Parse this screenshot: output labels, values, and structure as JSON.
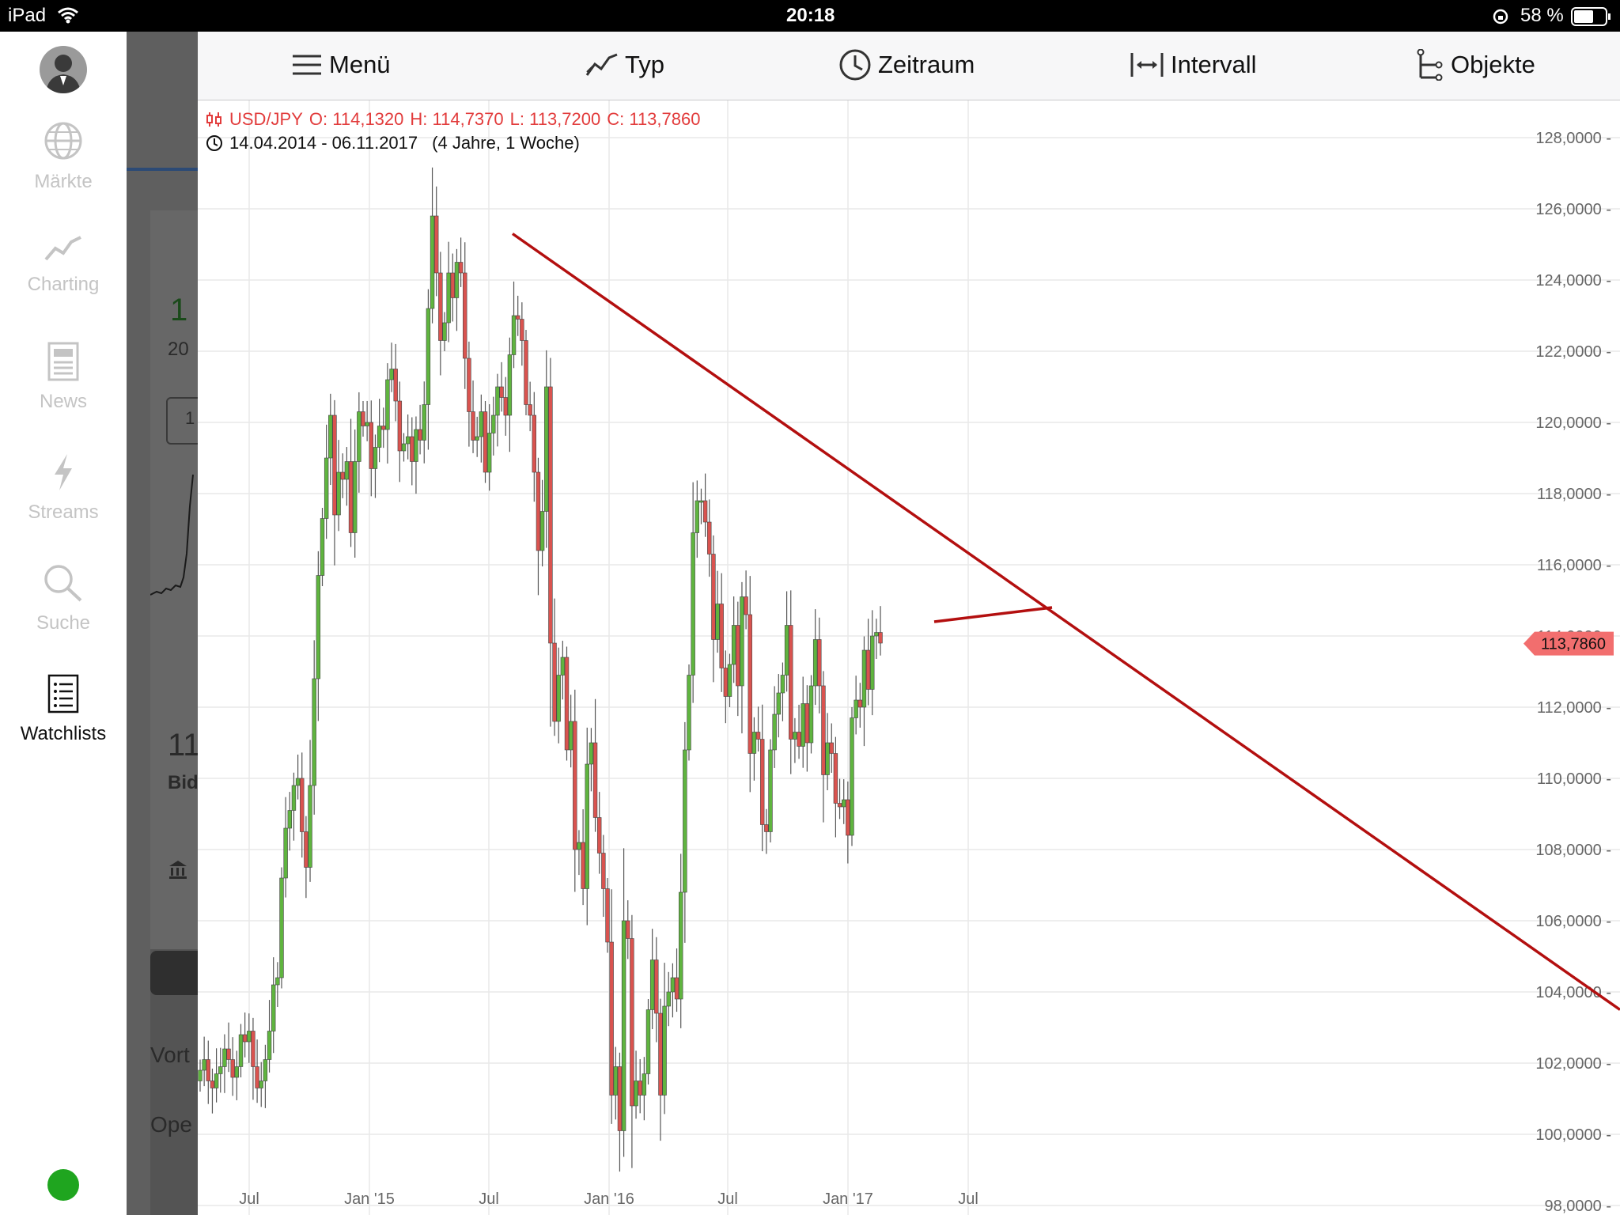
{
  "status_bar": {
    "device": "iPad",
    "time": "20:18",
    "battery": "58 %"
  },
  "sidebar": {
    "items": [
      {
        "label": "Märkte",
        "icon": "globe-icon",
        "active": false
      },
      {
        "label": "Charting",
        "icon": "chart-line-icon",
        "active": false
      },
      {
        "label": "News",
        "icon": "newspaper-icon",
        "active": false
      },
      {
        "label": "Streams",
        "icon": "lightning-icon",
        "active": false
      },
      {
        "label": "Suche",
        "icon": "search-icon",
        "active": false
      },
      {
        "label": "Watchlists",
        "icon": "list-icon",
        "active": true
      }
    ],
    "status_color": "#1fa51f"
  },
  "background_panel": {
    "fragments": [
      "1",
      "20",
      "1",
      "11",
      "Bid",
      "Vort",
      "Ope"
    ]
  },
  "toolbar": {
    "menu": "Menü",
    "type": "Typ",
    "period": "Zeitraum",
    "interval": "Intervall",
    "objects": "Objekte"
  },
  "instrument": {
    "symbol": "USD/JPY",
    "open": "O: 114,1320",
    "high": "H: 114,7370",
    "low": "L: 113,7200",
    "close": "C: 113,7860",
    "range": "14.04.2014 - 06.11.2017",
    "duration": "(4 Jahre, 1 Woche)"
  },
  "chart_data": {
    "type": "candlestick",
    "y_ticks": [
      "128,0000",
      "126,0000",
      "124,0000",
      "122,0000",
      "120,0000",
      "118,0000",
      "116,0000",
      "114,0000",
      "112,0000",
      "110,0000",
      "108,0000",
      "106,0000",
      "104,0000",
      "102,0000",
      "100,0000",
      "98,0000"
    ],
    "ylim": [
      98,
      128
    ],
    "x_ticks": [
      "Jul",
      "Jan '15",
      "Jul",
      "Jan '16",
      "Jul",
      "Jan '17",
      "Jul"
    ],
    "last_price": "113,7860",
    "up_color": "#5fb43f",
    "down_color": "#d9534f",
    "trendline_color": "#b30f0f",
    "weekly_closes": [
      101.8,
      102.1,
      101.5,
      101.3,
      101.7,
      101.9,
      102.4,
      102.1,
      101.6,
      101.9,
      102.8,
      102.6,
      102.9,
      101.9,
      101.3,
      101.5,
      102.1,
      102.9,
      104.2,
      104.4,
      107.2,
      108.6,
      109.1,
      109.8,
      110.0,
      108.5,
      107.5,
      109.8,
      112.8,
      115.7,
      117.3,
      119.0,
      120.2,
      117.4,
      118.6,
      118.4,
      118.9,
      116.9,
      118.9,
      120.3,
      119.9,
      120.0,
      118.7,
      119.3,
      119.9,
      119.8,
      121.2,
      121.5,
      120.6,
      119.2,
      119.4,
      119.6,
      118.9,
      119.8,
      119.5,
      120.5,
      123.2,
      125.8,
      124.2,
      122.3,
      122.8,
      124.2,
      123.5,
      124.5,
      124.2,
      121.8,
      120.3,
      119.5,
      119.6,
      120.3,
      118.6,
      119.7,
      120.2,
      121.0,
      120.7,
      120.2,
      121.9,
      123.0,
      122.9,
      122.3,
      120.5,
      120.2,
      118.6,
      116.4,
      117.5,
      121.0,
      113.8,
      111.6,
      112.9,
      113.4,
      110.8,
      111.6,
      108.0,
      108.2,
      106.9,
      110.4,
      111.0,
      108.9,
      107.9,
      106.9,
      105.4,
      101.1,
      101.9,
      100.1,
      106.0,
      105.5,
      100.8,
      101.5,
      101.1,
      101.7,
      103.5,
      104.9,
      103.4,
      101.1,
      103.6,
      104.0,
      104.4,
      103.8,
      106.8,
      110.8,
      112.9,
      116.9,
      117.8,
      117.8,
      117.2,
      116.3,
      113.9,
      114.9,
      113.1,
      112.3,
      113.2,
      114.3,
      112.6,
      115.1,
      114.6,
      110.7,
      111.3,
      111.1,
      108.7,
      108.5,
      110.8,
      111.8,
      112.4,
      112.9,
      114.3,
      111.1,
      111.3,
      110.9,
      112.1,
      111.0,
      112.6,
      113.9,
      112.6,
      110.1,
      111.0,
      110.7,
      109.3,
      109.2,
      109.4,
      108.4,
      111.7,
      112.2,
      112.0,
      113.6,
      112.5,
      114.0,
      114.1,
      113.8
    ],
    "trendlines": [
      {
        "from": {
          "date": "Aug 2015",
          "value": 125.3
        },
        "to": {
          "date": "beyond chart",
          "value": 103.5
        }
      },
      {
        "from": {
          "date": "Apr 2017",
          "value": 114.4
        },
        "to": {
          "date": "Nov 2017",
          "value": 114.8
        }
      }
    ]
  }
}
